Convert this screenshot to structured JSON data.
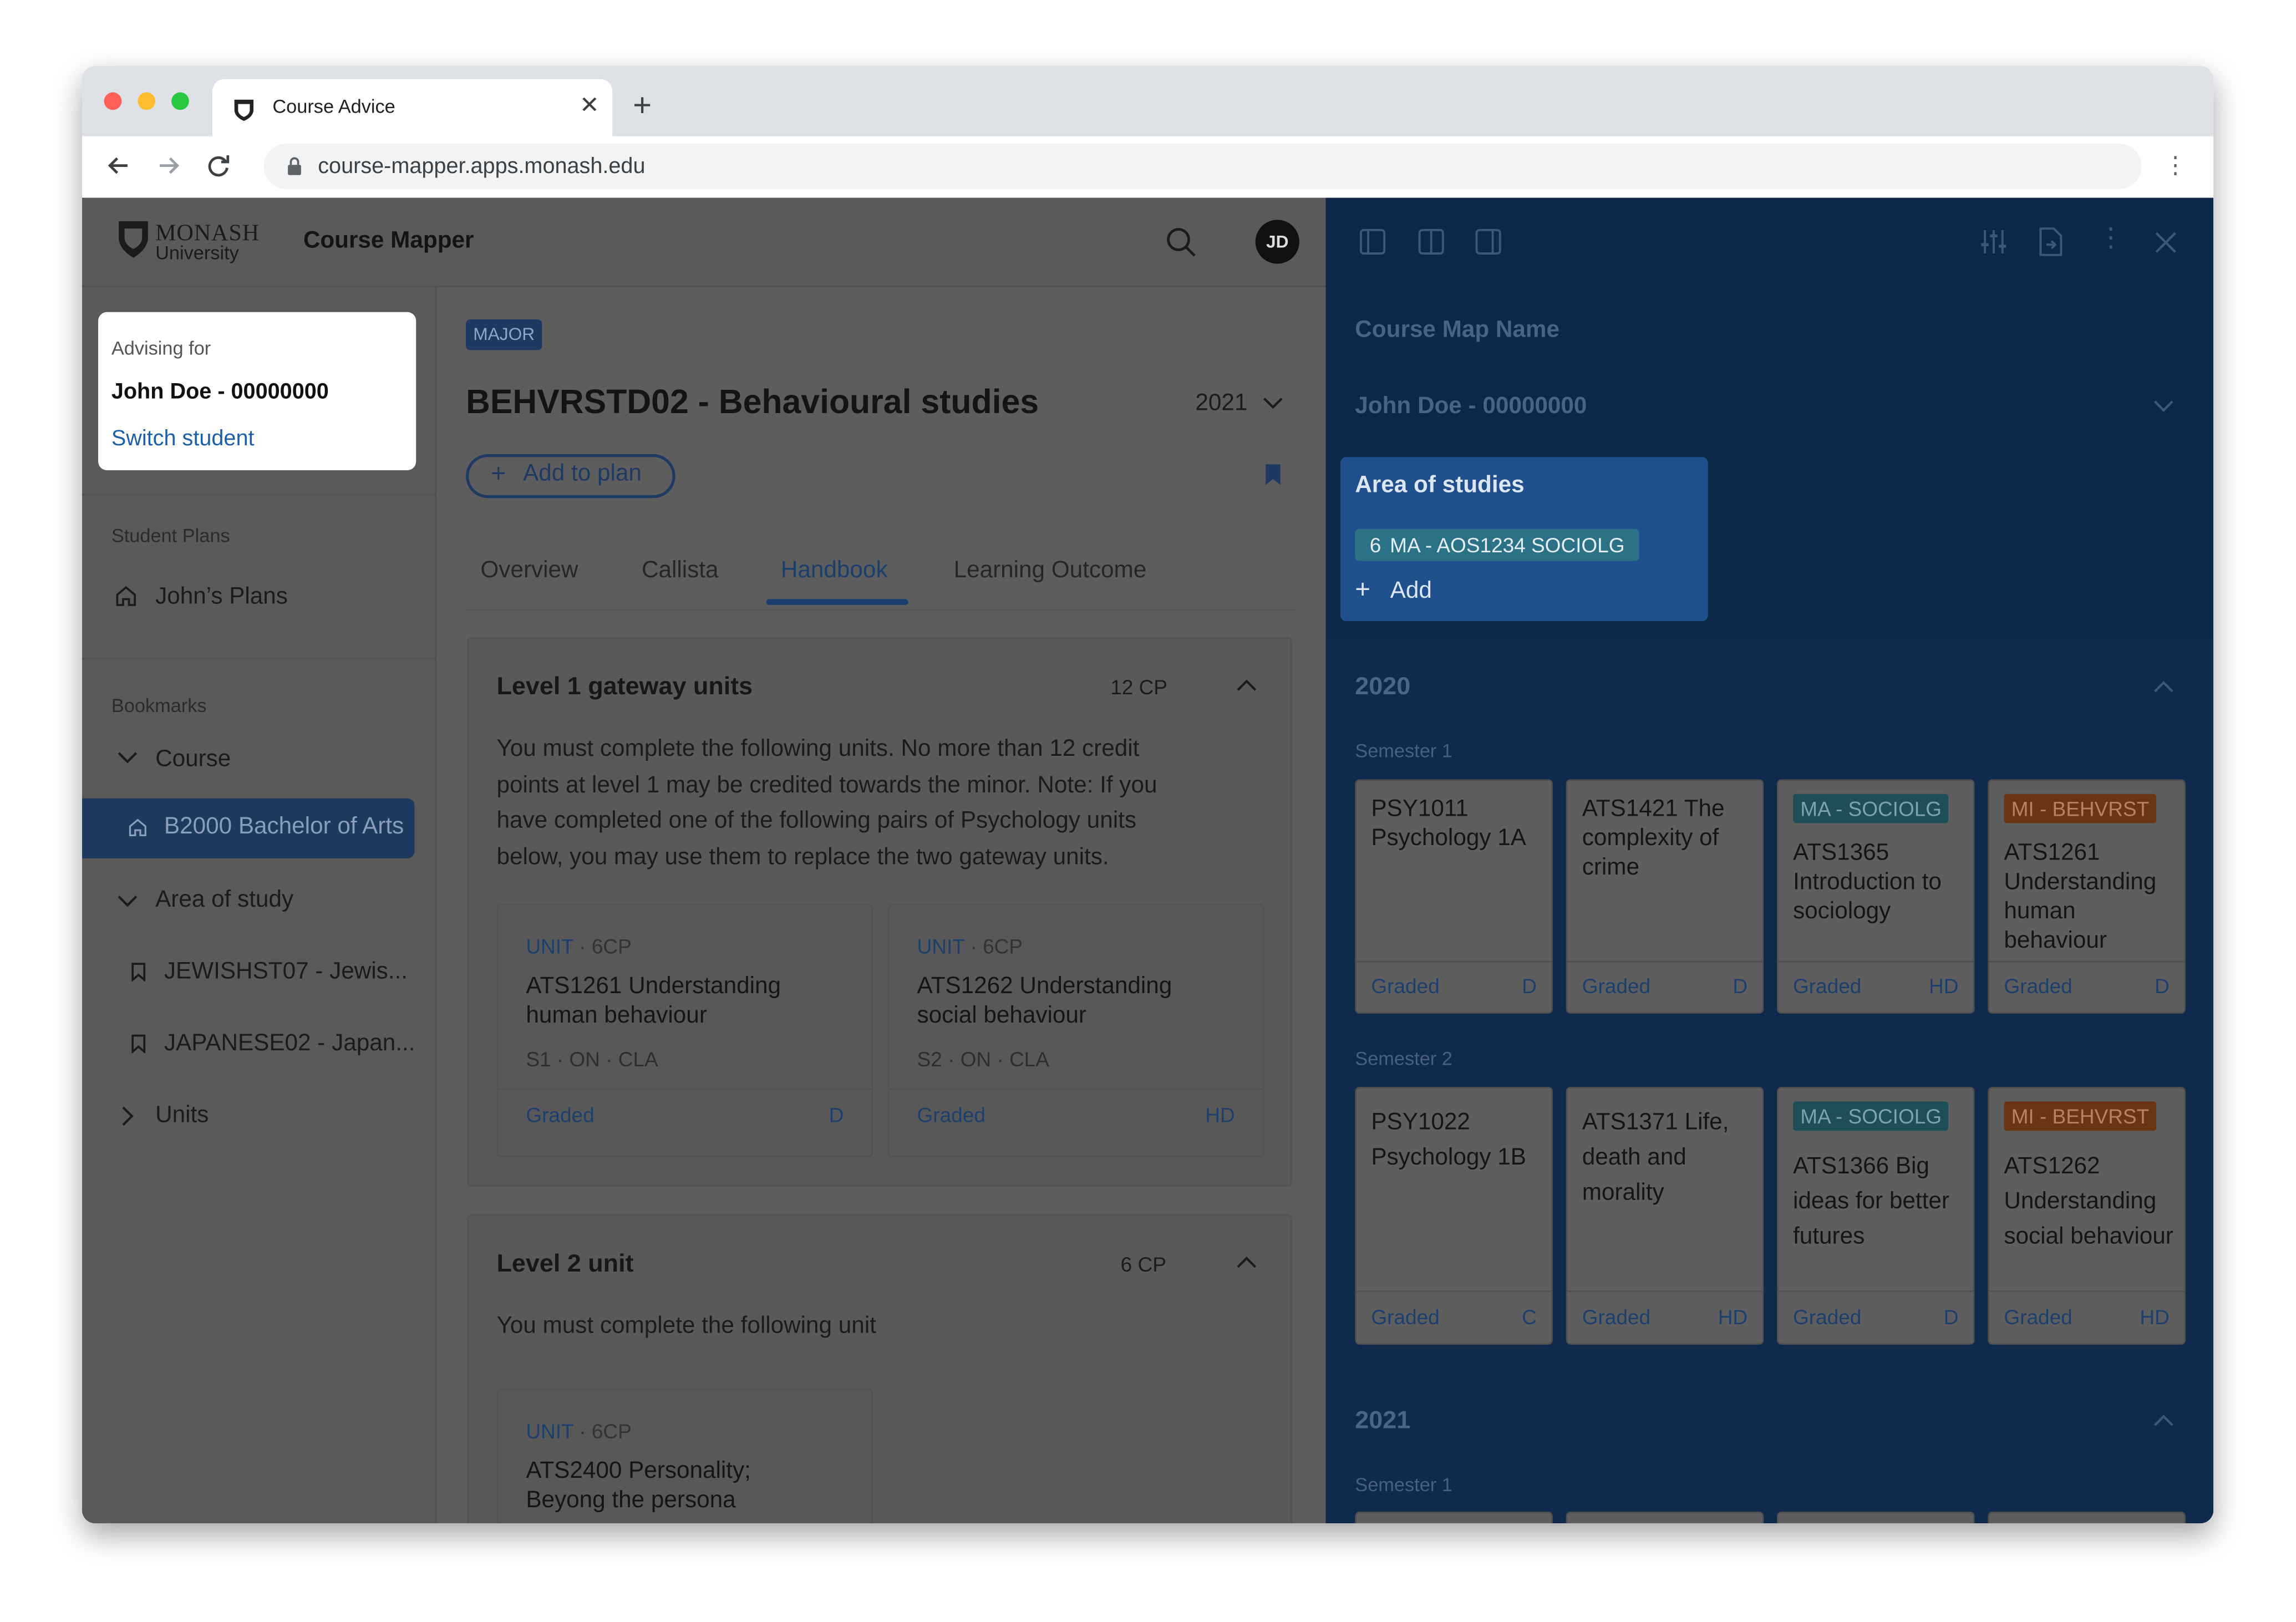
{
  "browser": {
    "tab_title": "Course Advice",
    "url": "course-mapper.apps.monash.edu"
  },
  "header": {
    "logo_line1": "MONASH",
    "logo_line2": "University",
    "app_title": "Course Mapper",
    "avatar_initials": "JD"
  },
  "sidebar": {
    "advising_label": "Advising for",
    "student": "John Doe - 00000000",
    "switch_label": "Switch student",
    "plans_heading": "Student Plans",
    "plans_item": "John’s Plans",
    "bookmarks_heading": "Bookmarks",
    "course_group": "Course",
    "course_item": "B2000 Bachelor of Arts",
    "area_group": "Area of study",
    "area_items": [
      "JEWISHST07 - Jewis...",
      "JAPANESE02 - Japan..."
    ],
    "units_group": "Units"
  },
  "main": {
    "badge": "MAJOR",
    "title": "BEHVRSTD02 - Behavioural studies",
    "year": "2021",
    "add_to_plan": "Add to plan",
    "tabs": [
      "Overview",
      "Callista",
      "Handbook",
      "Learning Outcome"
    ],
    "active_tab": "Handbook",
    "sections": [
      {
        "title": "Level 1 gateway units",
        "cp": "12 CP",
        "body": "You must complete the following units. No more than 12 credit points at level 1 may be credited towards the minor. Note: If you have completed one of the following pairs of Psychology units below, you may use them to replace the two gateway units.",
        "units": [
          {
            "kind": "UNIT",
            "cp": "6CP",
            "name": "ATS1261 Understanding human behaviour",
            "schedule": "S1 · ON · CLA",
            "status": "Graded",
            "grade": "D"
          },
          {
            "kind": "UNIT",
            "cp": "6CP",
            "name": "ATS1262 Understanding social behaviour",
            "schedule": "S2 · ON · CLA",
            "status": "Graded",
            "grade": "HD"
          }
        ]
      },
      {
        "title": "Level 2 unit",
        "cp": "6 CP",
        "body": "You must complete the following unit",
        "units": [
          {
            "kind": "UNIT",
            "cp": "6CP",
            "name": "ATS2400 Personality; Beyong the persona"
          }
        ]
      }
    ]
  },
  "panel": {
    "map_name": "Course Map Name",
    "student": "John Doe - 00000000",
    "aos": {
      "title": "Area of studies",
      "chip_count": "6",
      "chip_label": "MA - AOS1234 SOCIOLG",
      "add_label": "Add"
    },
    "years": [
      {
        "year": "2020",
        "semesters": [
          {
            "label": "Semester 1",
            "units": [
              {
                "tag": "",
                "code": "PSY1011 Psychology 1A",
                "status": "Graded",
                "grade": "D"
              },
              {
                "tag": "",
                "code": "ATS1421 The complexity of crime",
                "status": "Graded",
                "grade": "D"
              },
              {
                "tag": "MA - SOCIOLG",
                "code": "ATS1365 Introduction to sociology",
                "status": "Graded",
                "grade": "HD"
              },
              {
                "tag": "MI - BEHVRST",
                "code": "ATS1261 Understanding human behaviour",
                "status": "Graded",
                "grade": "D"
              }
            ]
          },
          {
            "label": "Semester 2",
            "units": [
              {
                "tag": "",
                "code": "PSY1022 Psychology 1B",
                "status": "Graded",
                "grade": "C"
              },
              {
                "tag": "",
                "code": "ATS1371 Life, death and morality",
                "status": "Graded",
                "grade": "HD"
              },
              {
                "tag": "MA - SOCIOLG",
                "code": "ATS1366 Big ideas for better futures",
                "status": "Graded",
                "grade": "D"
              },
              {
                "tag": "MI - BEHVRST",
                "code": "ATS1262 Understanding social behaviour",
                "status": "Graded",
                "grade": "HD"
              }
            ]
          }
        ]
      },
      {
        "year": "2021",
        "semesters": [
          {
            "label": "Semester 1",
            "units": []
          }
        ]
      }
    ]
  },
  "colors": {
    "overlay_gray": "#5d5d5d",
    "panel_navy": "#0f2a4d",
    "accent_blue": "#1f4f8c",
    "tag_major": "#1e4f59",
    "tag_minor": "#6b3512"
  }
}
